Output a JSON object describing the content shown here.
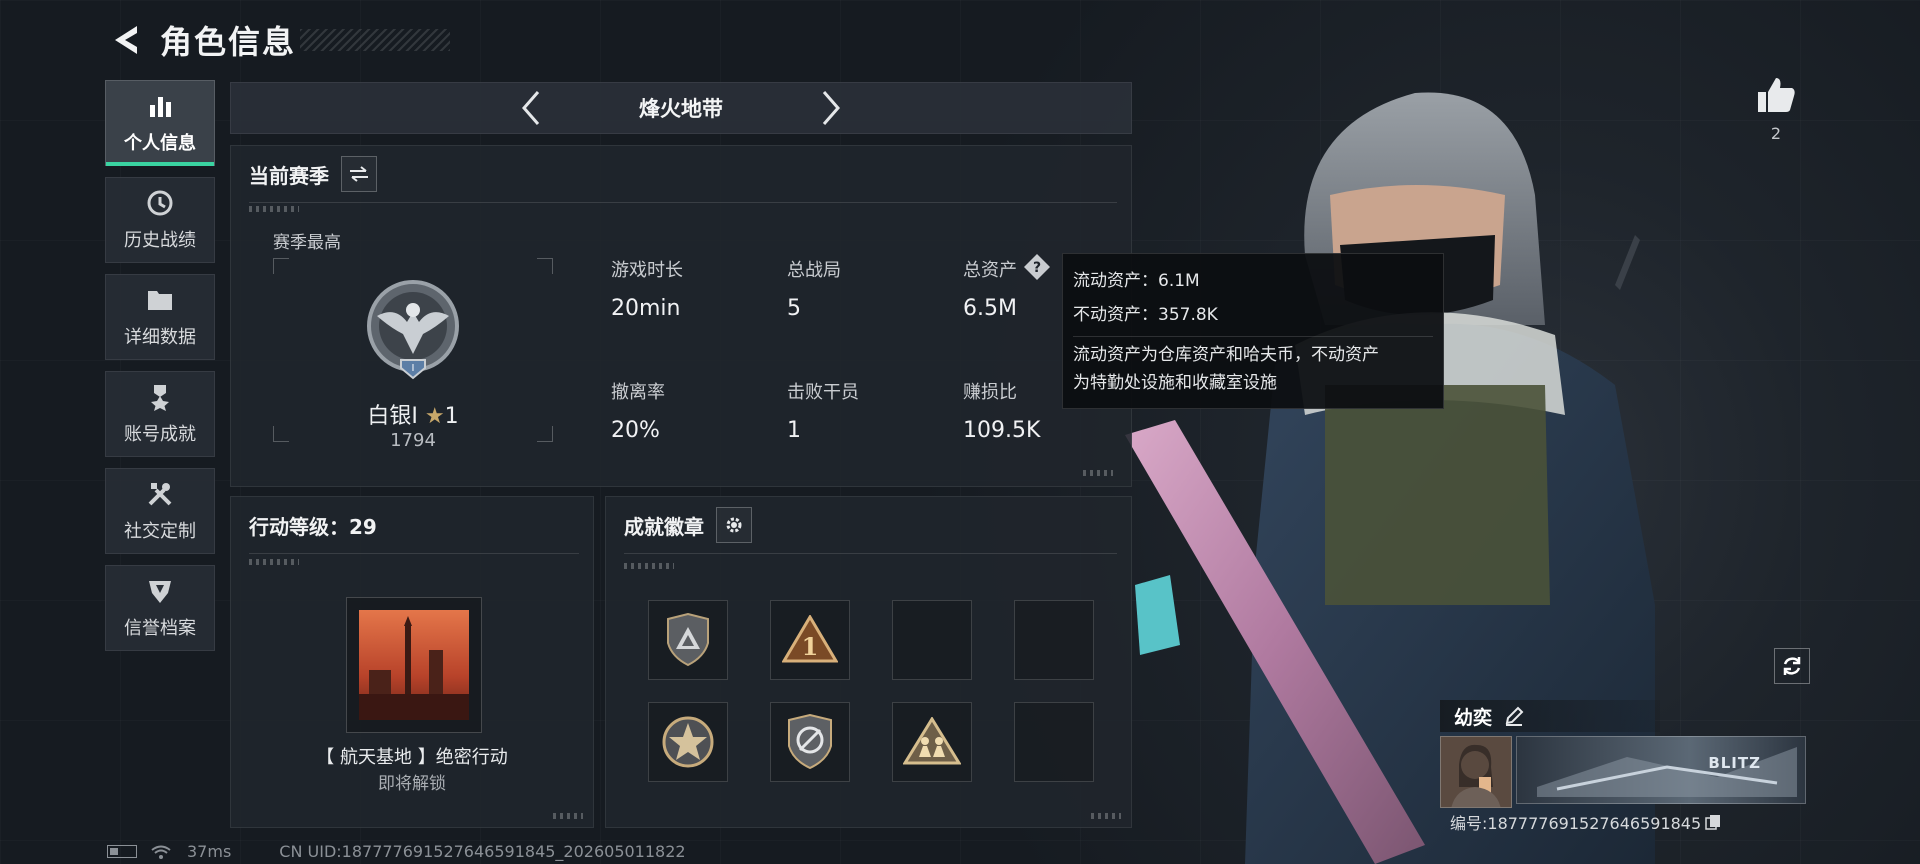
{
  "header": {
    "title": "角色信息"
  },
  "sidebar": {
    "items": [
      {
        "label": "个人信息",
        "icon": "bar-chart-icon",
        "active": true
      },
      {
        "label": "历史战绩",
        "icon": "history-icon"
      },
      {
        "label": "详细数据",
        "icon": "folder-icon"
      },
      {
        "label": "账号成就",
        "icon": "medal-icon"
      },
      {
        "label": "社交定制",
        "icon": "tools-icon"
      },
      {
        "label": "信誉档案",
        "icon": "shield-badge-icon"
      }
    ]
  },
  "mode": {
    "title": "烽火地带"
  },
  "season": {
    "title": "当前赛季",
    "best_label": "赛季最高",
    "rank_name": "白银I",
    "rank_stars": "1",
    "rank_score": "1794",
    "stats": [
      {
        "label": "游戏时长",
        "value": "20min"
      },
      {
        "label": "总战局",
        "value": "5"
      },
      {
        "label": "总资产",
        "value": "6.5M"
      },
      {
        "label": "撤离率",
        "value": "20%"
      },
      {
        "label": "击败干员",
        "value": "1"
      },
      {
        "label": "赚损比",
        "value": "109.5K"
      }
    ]
  },
  "tooltip": {
    "liquid": "流动资产：6.1M",
    "fixed": "不动资产：357.8K",
    "note_line1": "流动资产为仓库资产和哈夫币，不动资产",
    "note_line2": "为特勤处设施和收藏室设施"
  },
  "level": {
    "title": "行动等级：29",
    "name": "【 航天基地 】绝密行动",
    "sub": "即将解锁"
  },
  "badges": {
    "title": "成就徽章",
    "slots": [
      "triangle-shield-badge",
      "number-one-badge",
      "",
      "",
      "star-circle-badge",
      "crossed-circle-badge",
      "soldiers-triangle-badge",
      ""
    ]
  },
  "likes": {
    "count": "2"
  },
  "player": {
    "name": "幼奕",
    "banner_text": "BLITZ",
    "id": "编号:187777691527646591845"
  },
  "footer": {
    "ping": "37ms",
    "uid": "CN UID:187777691527646591845_202605011822"
  },
  "colors": {
    "accent": "#3ad3a1",
    "gold": "#c8a86a"
  }
}
